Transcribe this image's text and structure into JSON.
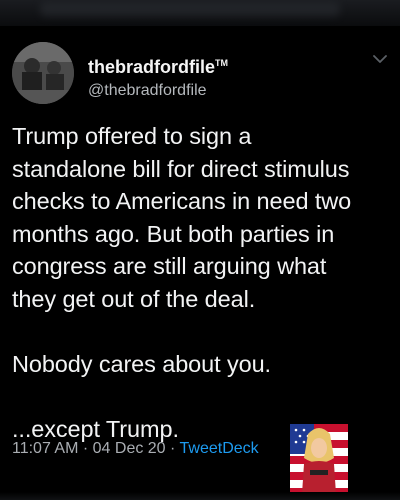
{
  "tweet": {
    "display_name": "thebradfordfile",
    "trademark": "TM",
    "handle": "@thebradfordfile",
    "text": "Trump offered to sign a\nstandalone bill for direct stimulus\nchecks to Americans in need two\nmonths ago. But both parties in\ncongress are still arguing what\nthey get out of the deal.\n\nNobody cares about you.\n\n...except Trump.",
    "time": "11:07 AM",
    "separator": " · ",
    "date": "04 Dec 20",
    "source": "TweetDeck"
  },
  "icons": {
    "menu": "chevron-down-icon",
    "avatar": "avatar",
    "sticker": "patriotic-sticker"
  },
  "colors": {
    "background": "#000000",
    "text": "#f2f3f4",
    "secondary": "#a9adb2",
    "link": "#1d9bf0"
  }
}
